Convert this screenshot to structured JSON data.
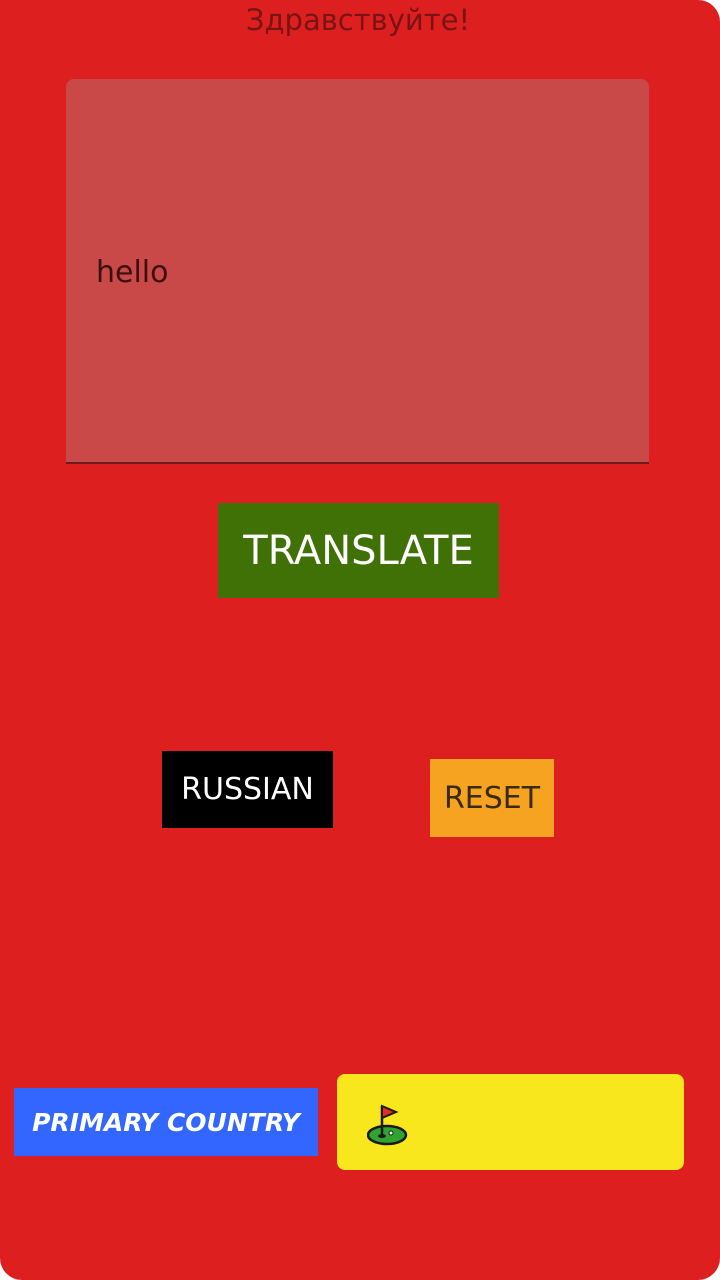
{
  "header": {
    "greeting": "Здравствуйте!"
  },
  "input": {
    "value": "hello"
  },
  "buttons": {
    "translate_label": "TRANSLATE",
    "language_label": "RUSSIAN",
    "reset_label": "RESET",
    "primary_country_label": "PRIMARY COUNTRY"
  },
  "country": {
    "icon": "golf-flag-icon"
  },
  "colors": {
    "background": "#dd1f1f",
    "input_background": "#c94848",
    "translate": "#3f7107",
    "language": "#000000",
    "reset": "#f5a320",
    "primary_country": "#3366ff",
    "country_box": "#f8e71c"
  }
}
